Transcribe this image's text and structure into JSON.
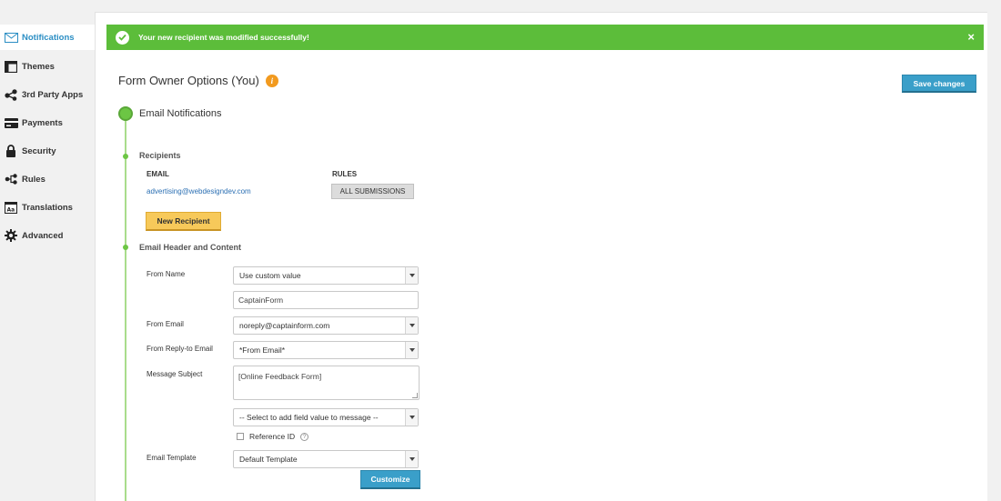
{
  "sidebar": {
    "items": [
      {
        "label": "Notifications",
        "icon": "envelope-icon",
        "active": true
      },
      {
        "label": "Themes",
        "icon": "layout-icon"
      },
      {
        "label": "3rd Party Apps",
        "icon": "share-icon"
      },
      {
        "label": "Payments",
        "icon": "credit-card-icon"
      },
      {
        "label": "Security",
        "icon": "lock-icon"
      },
      {
        "label": "Rules",
        "icon": "rules-icon"
      },
      {
        "label": "Translations",
        "icon": "translate-icon"
      },
      {
        "label": "Advanced",
        "icon": "gear-icon"
      }
    ]
  },
  "alert": {
    "message": "Your new recipient was modified successfully!",
    "close": "×"
  },
  "header": {
    "title": "Form Owner Options (You)",
    "info": "i",
    "save_label": "Save changes"
  },
  "section": {
    "title": "Email Notifications"
  },
  "recipients": {
    "title": "Recipients",
    "col_email": "EMAIL",
    "col_rules": "RULES",
    "rows": [
      {
        "email": "advertising@webdesigndev.com",
        "rule": "ALL SUBMISSIONS"
      }
    ],
    "new_label": "New Recipient"
  },
  "content": {
    "title": "Email Header and Content",
    "from_name_label": "From Name",
    "from_name_select": "Use custom value",
    "from_name_value": "CaptainForm",
    "from_email_label": "From Email",
    "from_email_select": "noreply@captainform.com",
    "reply_to_label": "From Reply-to Email",
    "reply_to_select": "*From Email*",
    "subject_label": "Message Subject",
    "subject_value": "[Online Feedback Form]",
    "field_select": "-- Select to add field value to message --",
    "reference_label": "Reference ID",
    "help": "?",
    "template_label": "Email Template",
    "template_select": "Default Template",
    "customize_label": "Customize"
  },
  "colors": {
    "accent": "#3a9fc9",
    "success": "#5cbd3a",
    "warning": "#f7c95a",
    "link": "#2b6fb3"
  }
}
